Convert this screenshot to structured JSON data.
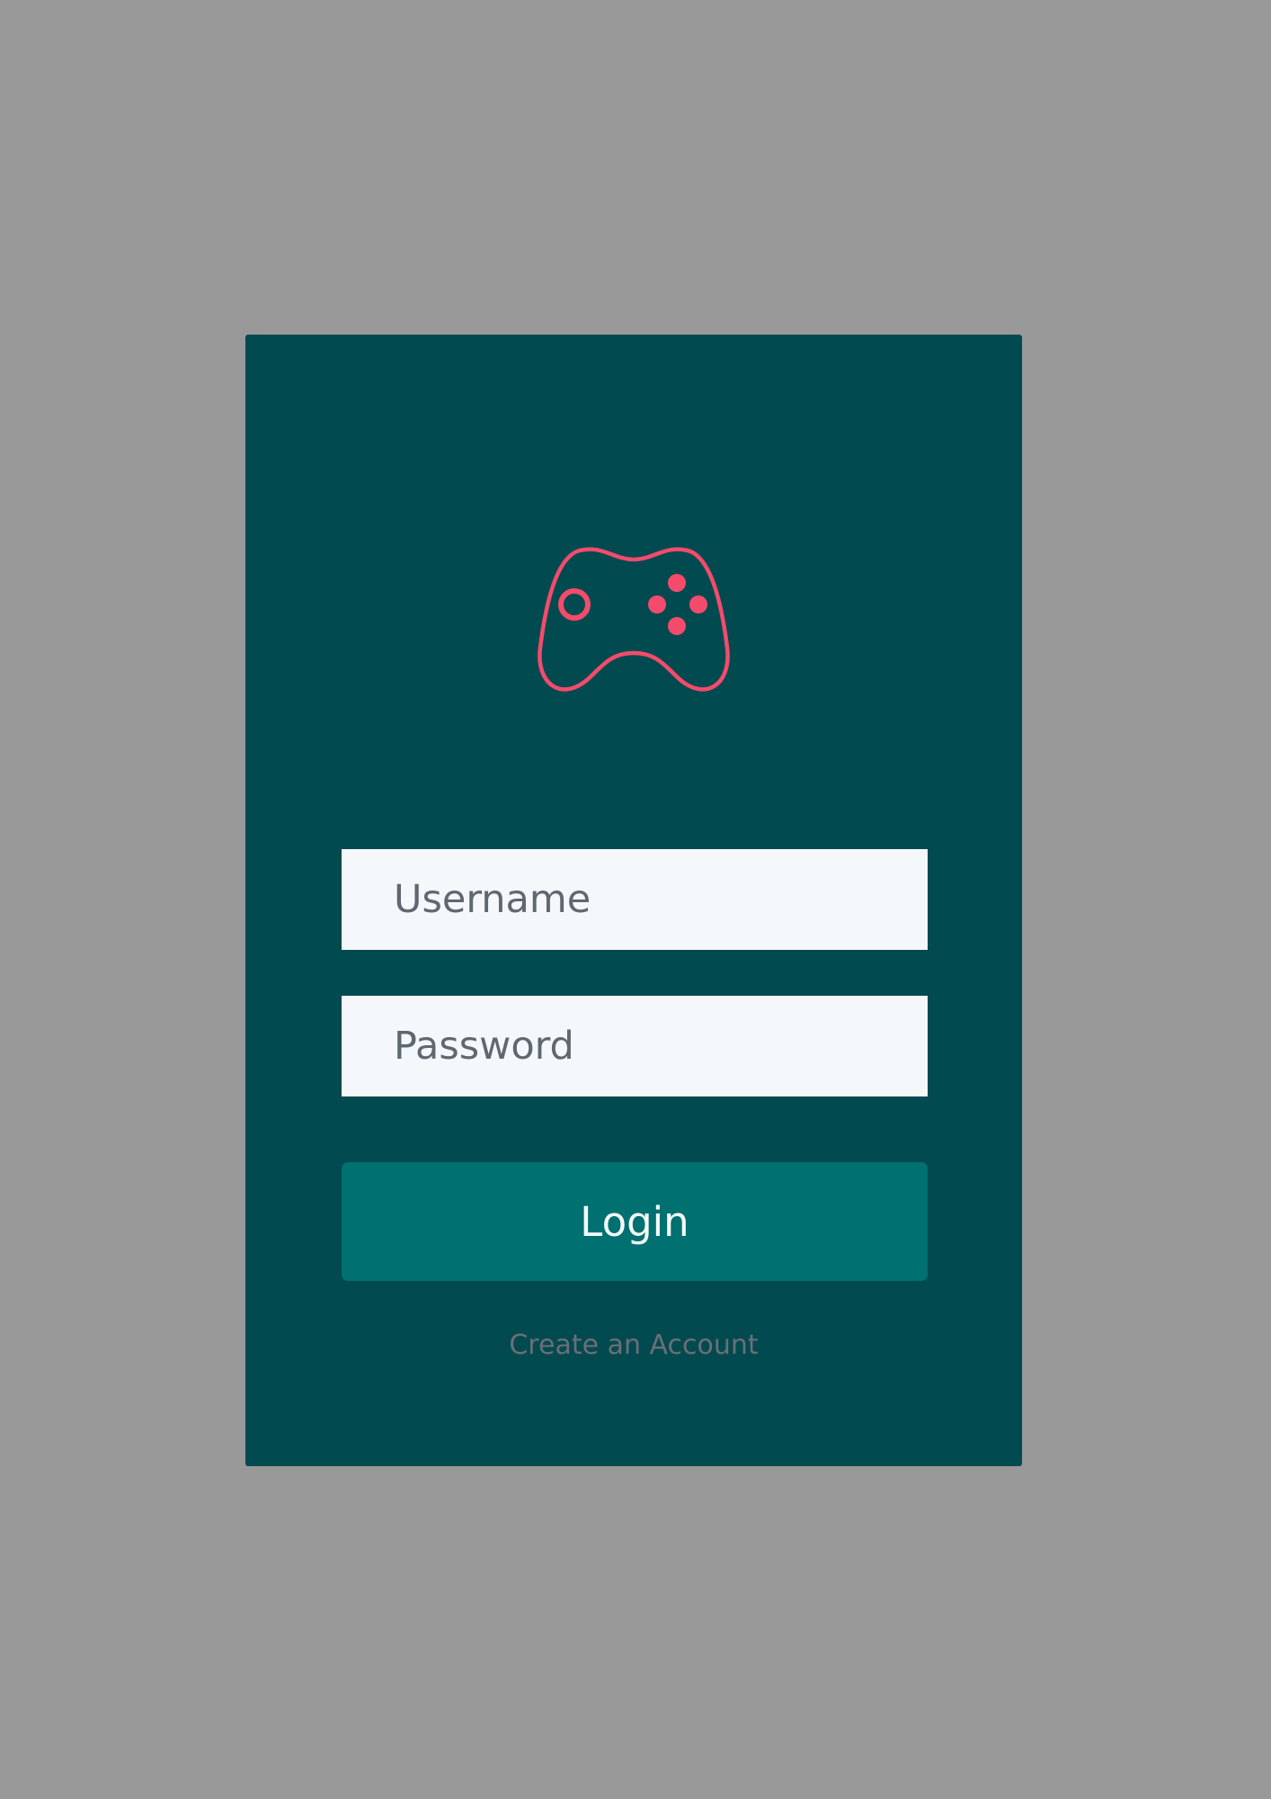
{
  "brand": {
    "icon": "gamepad-icon",
    "accent_color": "#f44b6c"
  },
  "login_form": {
    "username_placeholder": "Username",
    "password_placeholder": "Password",
    "submit_label": "Login",
    "create_account_label": "Create an Account"
  },
  "colors": {
    "page_background": "#999999",
    "card_background": "#004a50",
    "button_background": "#007070",
    "field_background": "#f5f8fb"
  }
}
